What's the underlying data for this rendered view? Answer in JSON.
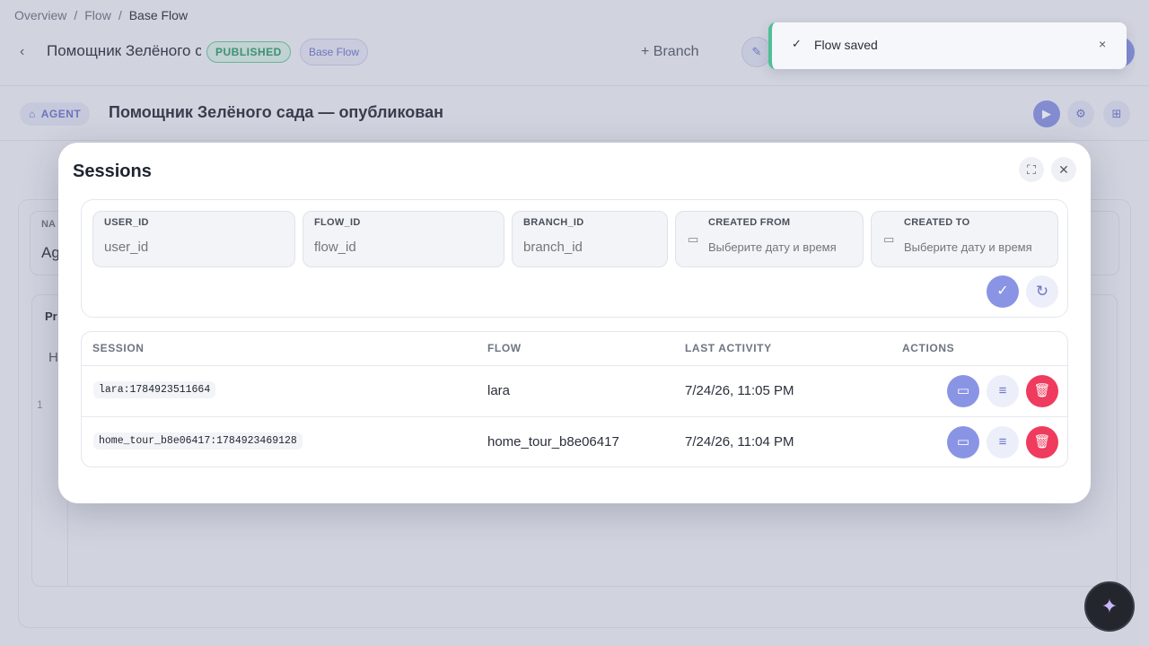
{
  "breadcrumb": {
    "items": [
      "Overview",
      "Flow"
    ],
    "current": "Base Flow",
    "sep": "/"
  },
  "header": {
    "back_icon": "‹",
    "flow_name": "Помощник Зелёного сад",
    "status_badge": "PUBLISHED",
    "flow_badge": "Base Flow",
    "branch_label": "+  Branch",
    "edit_icon": "✎"
  },
  "agent_bar": {
    "badge": "AGENT",
    "title": "Помощник Зелёного сада — опубликован",
    "icons": [
      "play-icon",
      "gear-icon",
      "flow-tree-icon"
    ]
  },
  "background_form": {
    "name_label": "NA",
    "name_value": "Ag",
    "prompt_label": "Pr",
    "prompt_h": "H",
    "line_no": "1"
  },
  "toast": {
    "icon": "✓",
    "message": "Flow saved",
    "close": "×"
  },
  "modal": {
    "title": "Sessions",
    "filters": {
      "user_id": {
        "label": "USER_ID",
        "placeholder": "user_id"
      },
      "flow_id": {
        "label": "FLOW_ID",
        "placeholder": "flow_id"
      },
      "branch_id": {
        "label": "BRANCH_ID",
        "placeholder": "branch_id"
      },
      "created_from": {
        "label": "CREATED FROM",
        "placeholder": "Выберите дату и время"
      },
      "created_to": {
        "label": "CREATED TO",
        "placeholder": "Выберите дату и время"
      }
    },
    "table": {
      "columns": [
        "SESSION",
        "FLOW",
        "LAST ACTIVITY",
        "ACTIONS"
      ],
      "rows": [
        {
          "session": "lara:1784923511664",
          "flow": "lara",
          "last_activity": "7/24/26, 11:05 PM"
        },
        {
          "session": "home_tour_b8e06417:1784923469128",
          "flow": "home_tour_b8e06417",
          "last_activity": "7/24/26, 11:04 PM"
        }
      ]
    }
  },
  "colors": {
    "accent": "#8a94e4",
    "danger": "#ef3b5d",
    "success": "#4fbf95"
  }
}
